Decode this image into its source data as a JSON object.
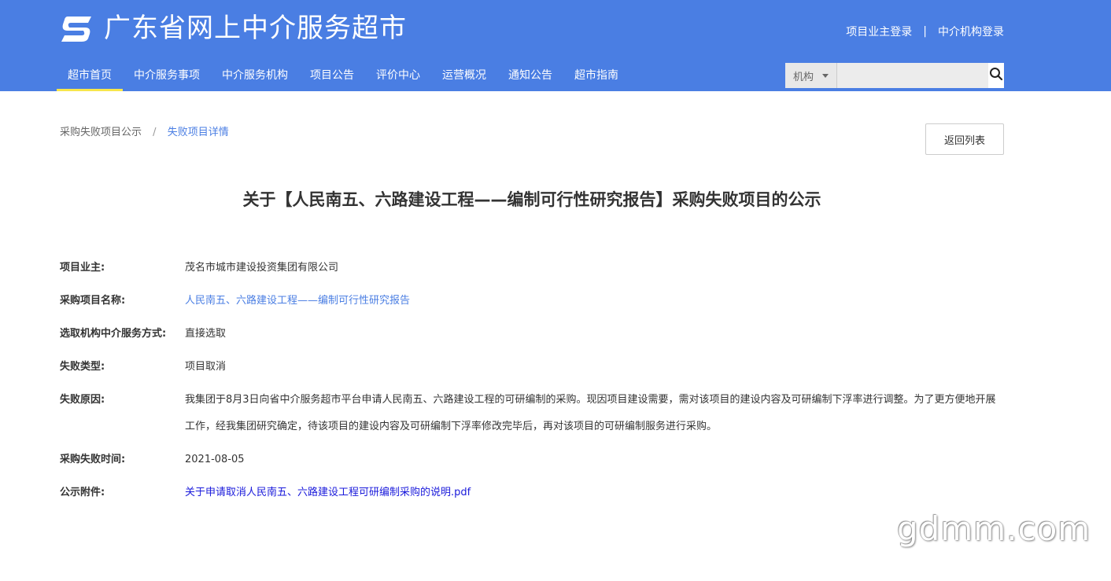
{
  "header": {
    "site_title": "广东省网上中介服务超市",
    "owner_login": "项目业主登录",
    "separator": "|",
    "agency_login": "中介机构登录",
    "accent_color": "#4a7ee3",
    "active_underline_color": "#f7e64b"
  },
  "nav": {
    "items": [
      "超市首页",
      "中介服务事项",
      "中介服务机构",
      "项目公告",
      "评价中心",
      "运营概况",
      "通知公告",
      "超市指南"
    ],
    "active": "超市首页"
  },
  "search": {
    "select_value": "机构",
    "input_value": "",
    "icon": "search-icon"
  },
  "breadcrumb": {
    "parent": "采购失败项目公示",
    "separator": "/",
    "current": "失败项目详情"
  },
  "back_button": "返回列表",
  "title": "关于【人民南五、六路建设工程——编制可行性研究报告】采购失败项目的公示",
  "details": {
    "owner_label": "项目业主:",
    "owner_value": "茂名市城市建设投资集团有限公司",
    "project_label": "采购项目名称:",
    "project_value": "人民南五、六路建设工程——编制可行性研究报告",
    "method_label": "选取机构中介服务方式:",
    "method_value": "直接选取",
    "type_label": "失败类型:",
    "type_value": "项目取消",
    "reason_label": "失败原因:",
    "reason_value": "我集团于8月3日向省中介服务超市平台申请人民南五、六路建设工程的可研编制的采购。现因项目建设需要，需对该项目的建设内容及可研编制下浮率进行调整。为了更方便地开展工作，经我集团研究确定，待该项目的建设内容及可研编制下浮率修改完毕后，再对该项目的可研编制服务进行采购。",
    "time_label": "采购失败时间:",
    "time_value": "2021-08-05",
    "attachment_label": "公示附件:",
    "attachment_value": "关于申请取消人民南五、六路建设工程可研编制采购的说明.pdf"
  },
  "watermark": "gdmm.com"
}
